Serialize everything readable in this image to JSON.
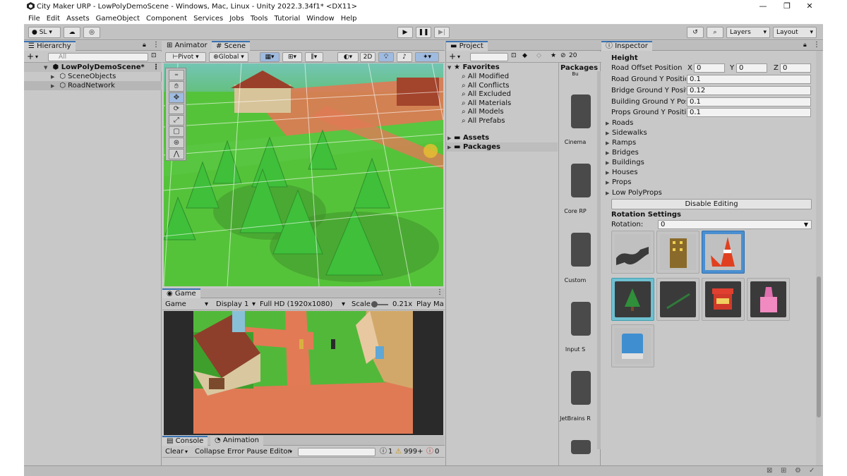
{
  "window": {
    "title": "City Maker URP - LowPolyDemoScene - Windows, Mac, Linux - Unity 2022.3.34f1* <DX11>",
    "minimize": "—",
    "maximize": "❐",
    "close": "✕"
  },
  "menu": [
    "File",
    "Edit",
    "Assets",
    "GameObject",
    "Component",
    "Services",
    "Jobs",
    "Tools",
    "Tutorial",
    "Window",
    "Help"
  ],
  "toolbar": {
    "account": "SL",
    "layers": "Layers",
    "layout": "Layout"
  },
  "hierarchy": {
    "tab": "Hierarchy",
    "search_placeholder": "All",
    "scene": "LowPolyDemoScene*",
    "children": [
      "SceneObjects",
      "RoadNetwork"
    ]
  },
  "scene_view": {
    "tabs": [
      "Animator",
      "Scene"
    ],
    "pivot": "Pivot",
    "global": "Global",
    "mode_2d": "2D"
  },
  "game_view": {
    "tab": "Game",
    "display_mode": "Game",
    "display": "Display 1",
    "resolution": "Full HD (1920x1080)",
    "scale_label": "Scale",
    "scale_value": "0.21x",
    "play_mode": "Play Ma"
  },
  "console": {
    "tabs": [
      "Console",
      "Animation"
    ],
    "clear": "Clear",
    "collapse": "Collapse",
    "error_pause": "Error Pause",
    "editor": "Editor",
    "info_count": "1",
    "warning_count": "999+",
    "error_count": "0"
  },
  "project": {
    "tab": "Project",
    "hidden_count": "20",
    "favorites_label": "Favorites",
    "favorites": [
      "All Modified",
      "All Conflicts",
      "All Excluded",
      "All Materials",
      "All Models",
      "All Prefabs"
    ],
    "folders": [
      "Assets",
      "Packages"
    ],
    "packages_header": "Packages",
    "packages_top": "Bu",
    "packages": [
      "Cinema",
      "Core RP",
      "Custom",
      "Input S",
      "JetBrains R"
    ]
  },
  "inspector": {
    "tab": "Inspector",
    "section": "Height",
    "fields": [
      {
        "label": "Road Offset Position",
        "x": "0",
        "y": "0",
        "z": "0"
      },
      {
        "label": "Road Ground Y Position",
        "value": "0.1"
      },
      {
        "label": "Bridge Ground Y Positio",
        "value": "0.12"
      },
      {
        "label": "Building Ground Y Positi",
        "value": "0.1"
      },
      {
        "label": "Props Ground Y Position",
        "value": "0.1"
      }
    ],
    "foldouts": [
      "Roads",
      "Sidewalks",
      "Ramps",
      "Bridges",
      "Buildings",
      "Houses",
      "Props",
      "Low PolyProps"
    ],
    "disable_button": "Disable Editing",
    "rotation_section": "Rotation Settings",
    "rotation_label": "Rotation:",
    "rotation_value": "0",
    "axis_labels": [
      "X",
      "Y",
      "Z"
    ],
    "palette": [
      "road-curve",
      "building",
      "traffic-cone",
      "tree",
      "pipe",
      "market-stall",
      "pink-tower",
      "blue-box"
    ]
  },
  "colors": {
    "accent": "#3a72b0",
    "panel": "#c8c8c8",
    "selected": "#a6b8d0"
  }
}
